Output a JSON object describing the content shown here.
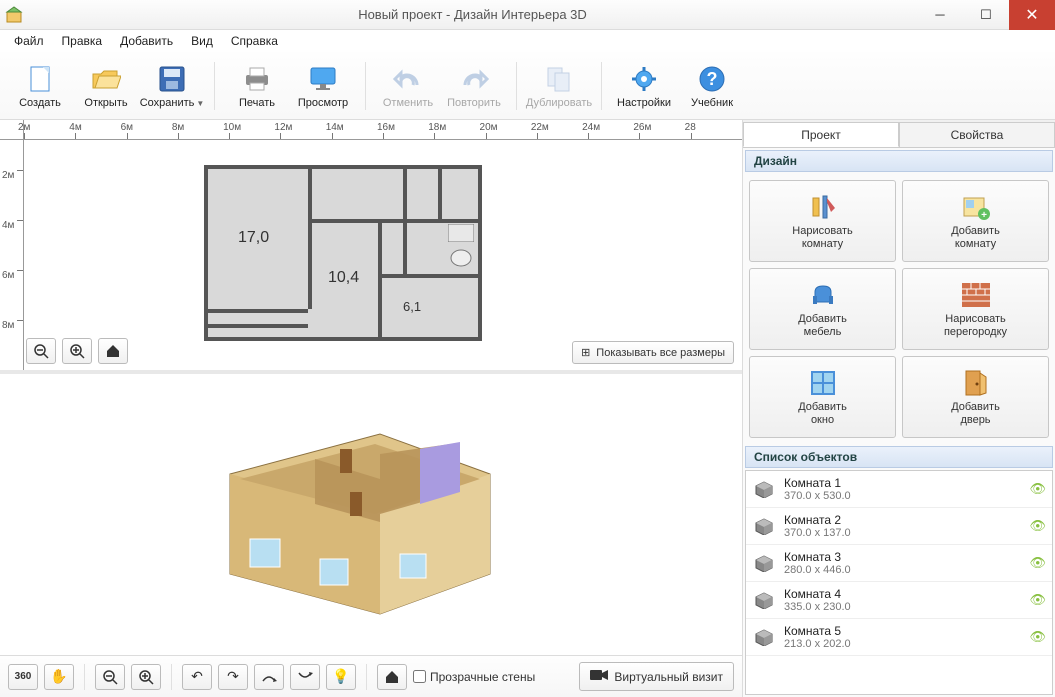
{
  "app": {
    "title": "Новый проект - Дизайн Интерьера 3D"
  },
  "menu": {
    "file": "Файл",
    "edit": "Правка",
    "add": "Добавить",
    "view": "Вид",
    "help": "Справка"
  },
  "toolbar": {
    "create": "Создать",
    "open": "Открыть",
    "save": "Сохранить",
    "print": "Печать",
    "preview": "Просмотр",
    "undo": "Отменить",
    "redo": "Повторить",
    "duplicate": "Дублировать",
    "settings": "Настройки",
    "tutorial": "Учебник"
  },
  "ruler_h": [
    "2м",
    "4м",
    "6м",
    "8м",
    "10м",
    "12м",
    "14м",
    "16м",
    "18м",
    "20м",
    "22м",
    "24м",
    "26м",
    "28"
  ],
  "ruler_v": [
    "2м",
    "4м",
    "6м",
    "8м"
  ],
  "rooms": {
    "r1": "17,0",
    "r2": "10,4",
    "r3": "6,1"
  },
  "view2d": {
    "show_dims": "Показывать все размеры"
  },
  "bottom": {
    "transparent_walls": "Прозрачные стены",
    "virtual_visit": "Виртуальный визит"
  },
  "panel": {
    "tab_project": "Проект",
    "tab_properties": "Свойства",
    "design_header": "Дизайн",
    "buttons": {
      "draw_room_l1": "Нарисовать",
      "draw_room_l2": "комнату",
      "add_room_l1": "Добавить",
      "add_room_l2": "комнату",
      "add_furn_l1": "Добавить",
      "add_furn_l2": "мебель",
      "draw_part_l1": "Нарисовать",
      "draw_part_l2": "перегородку",
      "add_win_l1": "Добавить",
      "add_win_l2": "окно",
      "add_door_l1": "Добавить",
      "add_door_l2": "дверь"
    },
    "objects_header": "Список объектов"
  },
  "objects": [
    {
      "name": "Комната 1",
      "dims": "370.0 x 530.0"
    },
    {
      "name": "Комната 2",
      "dims": "370.0 x 137.0"
    },
    {
      "name": "Комната 3",
      "dims": "280.0 x 446.0"
    },
    {
      "name": "Комната 4",
      "dims": "335.0 x 230.0"
    },
    {
      "name": "Комната 5",
      "dims": "213.0 x 202.0"
    }
  ]
}
